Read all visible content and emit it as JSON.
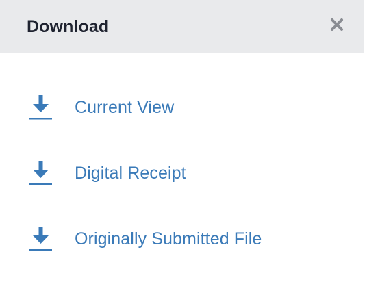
{
  "header": {
    "title": "Download",
    "close_icon": "close-icon"
  },
  "colors": {
    "header_bg": "#e9eaec",
    "accent": "#3a7ab8",
    "title_text": "#1f2330",
    "close_icon": "#8a8d93"
  },
  "items": [
    {
      "label": "Current View",
      "icon": "download-icon"
    },
    {
      "label": "Digital Receipt",
      "icon": "download-icon"
    },
    {
      "label": "Originally Submitted File",
      "icon": "download-icon"
    }
  ]
}
